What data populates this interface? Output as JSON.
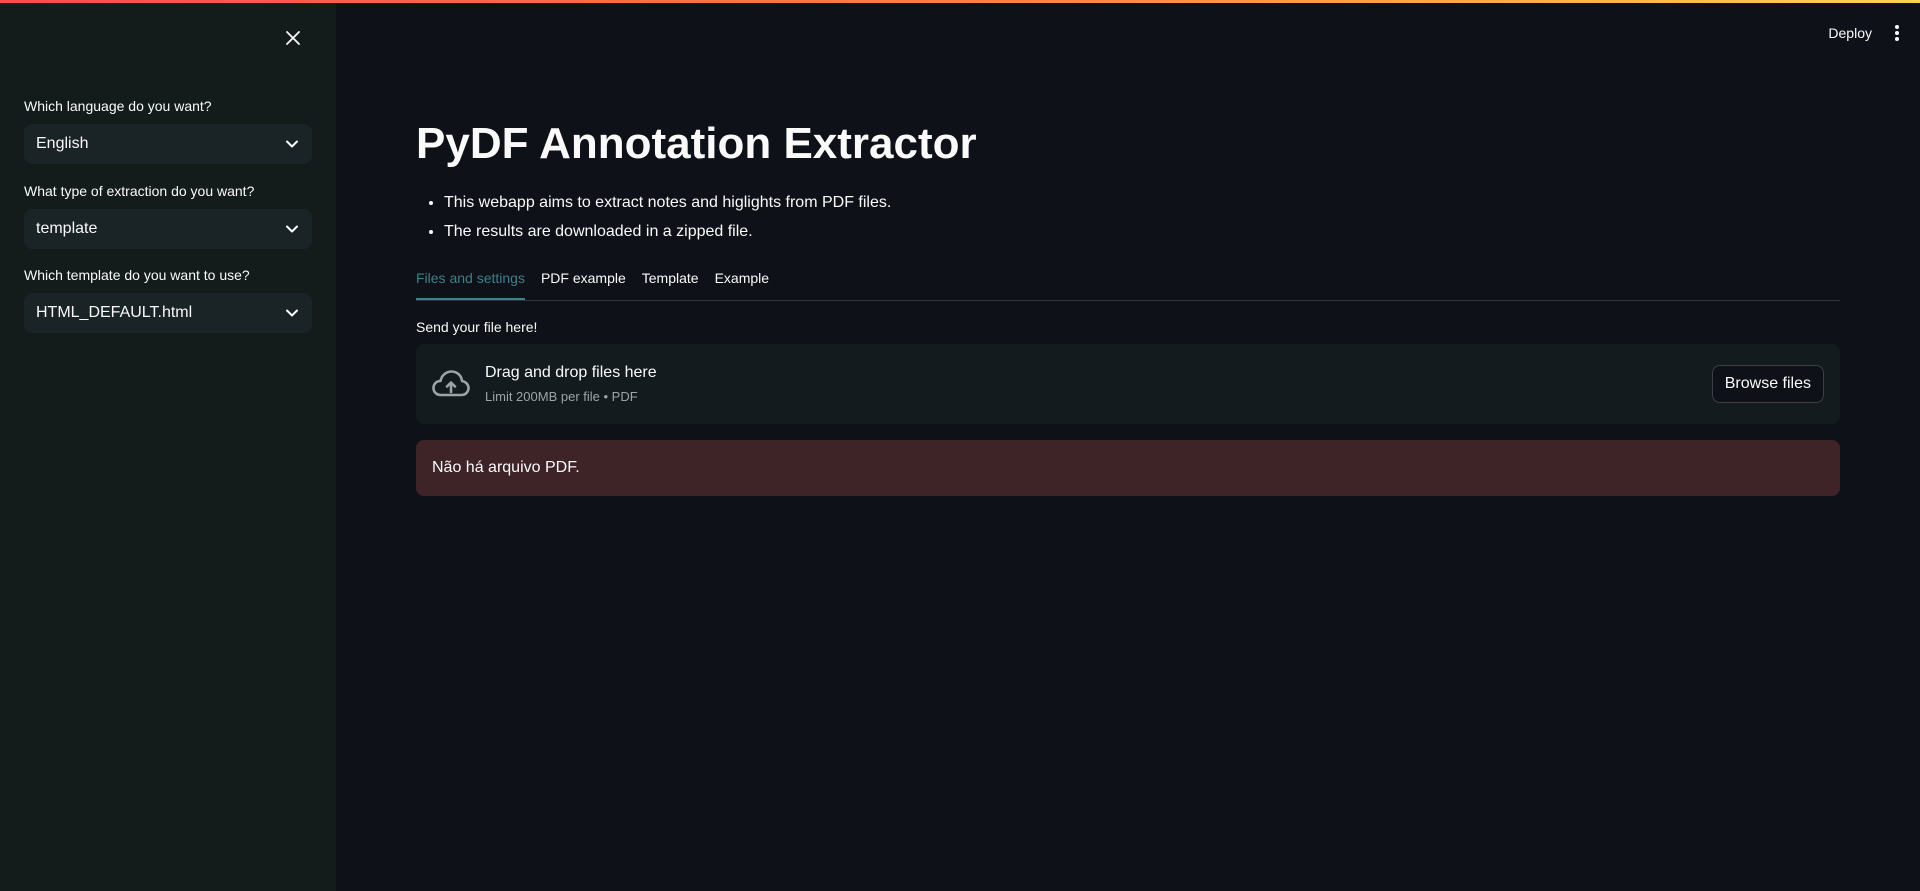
{
  "sidebar": {
    "fields": [
      {
        "label": "Which language do you want?",
        "value": "English"
      },
      {
        "label": "What type of extraction do you want?",
        "value": "template"
      },
      {
        "label": "Which template do you want to use?",
        "value": "HTML_DEFAULT.html"
      }
    ]
  },
  "header": {
    "deploy_label": "Deploy"
  },
  "main": {
    "title": "PyDF Annotation Extractor",
    "bullets": [
      "This webapp aims to extract notes and higlights from PDF files.",
      "The results are downloaded in a zipped file."
    ],
    "tabs": [
      {
        "label": "Files and settings",
        "active": true
      },
      {
        "label": "PDF example",
        "active": false
      },
      {
        "label": "Template",
        "active": false
      },
      {
        "label": "Example",
        "active": false
      }
    ],
    "uploader": {
      "label": "Send your file here!",
      "drop_text": "Drag and drop files here",
      "limit_text": "Limit 200MB per file • PDF",
      "browse_label": "Browse files"
    },
    "alert": {
      "text": "Não há arquivo PDF."
    }
  },
  "colors": {
    "accent": "#3d8189",
    "alert_bg": "#3e2327",
    "sidebar_bg": "#131b1b",
    "main_bg": "#0e1117"
  }
}
